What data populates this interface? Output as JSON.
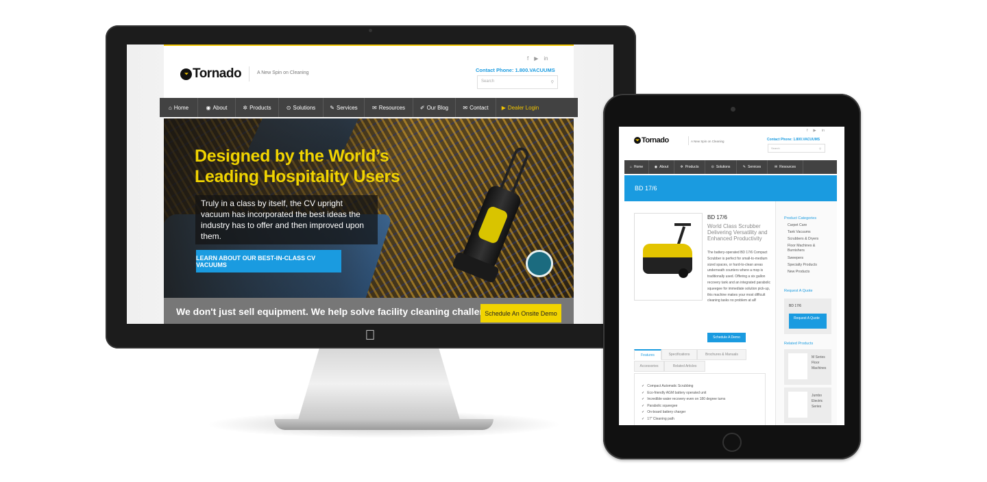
{
  "desktop": {
    "logo_text": "Tornado",
    "tagline": "A New Spin on Cleaning",
    "social": [
      "f",
      "▶",
      "in"
    ],
    "contact_phone": "Contact Phone: 1.800.VACUUMS",
    "search_placeholder": "Search",
    "nav": [
      {
        "icon": "⌂",
        "label": "Home"
      },
      {
        "icon": "◉",
        "label": "About"
      },
      {
        "icon": "✲",
        "label": "Products"
      },
      {
        "icon": "⊙",
        "label": "Solutions"
      },
      {
        "icon": "✎",
        "label": "Services"
      },
      {
        "icon": "✉",
        "label": "Resources"
      },
      {
        "icon": "✐",
        "label": "Our Blog"
      },
      {
        "icon": "✉",
        "label": "Contact"
      },
      {
        "icon": "▶",
        "label": "Dealer Login"
      }
    ],
    "hero": {
      "heading": "Designed by the World’s Leading Hospitality Users",
      "copy": "Truly in a class by itself, the CV upright vacuum has incorporated the best ideas the industry has to offer and then improved upon them.",
      "button": "LEARN ABOUT OUR BEST-IN-CLASS CV VACUUMS"
    },
    "band": {
      "text": "We don't just sell equipment. We help solve facility cleaning challenges.",
      "button": "Schedule An Onsite Demo"
    }
  },
  "tablet": {
    "logo_text": "Tornado",
    "tagline": "A New Spin on Cleaning",
    "contact_phone": "Contact Phone: 1.800.VACUUMS",
    "search_placeholder": "Search",
    "nav": [
      {
        "icon": "⌂",
        "label": "Home"
      },
      {
        "icon": "◉",
        "label": "About"
      },
      {
        "icon": "✲",
        "label": "Products"
      },
      {
        "icon": "⊙",
        "label": "Solutions"
      },
      {
        "icon": "✎",
        "label": "Services"
      },
      {
        "icon": "✉",
        "label": "Resources"
      }
    ],
    "banner": "BD 17/6",
    "product": {
      "title": "BD 17/6",
      "subtitle": "World Class Scrubber Delivering Versatility and Enhanced Productivity",
      "description": "The battery-operated BD 17/6 Compact Scrubber is perfect for small-to-medium sized spaces, or hard-to-clean areas underneath counters where a mop is traditionally used. Offering a six gallon recovery tank and an integrated parabolic squeegee for immediate solution pick-up, this machine makes your most difficult cleaning tasks no problem at all!",
      "demo_button": "Schedule A Demo"
    },
    "tabs": [
      "Features",
      "Specifications",
      "Brochures & Manuals",
      "Accessories",
      "Related Articles"
    ],
    "features": [
      "Compact Automatic Scrubbing",
      "Eco-friendly AGM battery operated unit",
      "Incredible water recovery even on 180 degree turns",
      "Parabolic squeegee",
      "On-board battery charger",
      "17\" Cleaning path"
    ],
    "sidebar": {
      "categories_heading": "Product Categories",
      "categories": [
        "Carpet Care",
        "Tank Vacuums",
        "Scrubbers & Dryers",
        "Floor Machines &",
        "Burnishers",
        "Sweepers",
        "Specialty Products",
        "New Products"
      ],
      "quote_heading": "Request A Quote",
      "quote_product": "BD 17/6",
      "quote_button": "Request A Quote",
      "related_heading": "Related Products",
      "related": [
        "M Series Floor Machines",
        "Jumbo Electric Series"
      ]
    }
  }
}
